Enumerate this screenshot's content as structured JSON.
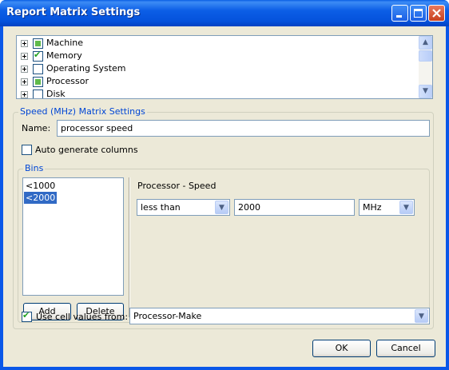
{
  "window": {
    "title": "Report Matrix Settings"
  },
  "tree": {
    "items": [
      {
        "label": "Machine",
        "state": "partial"
      },
      {
        "label": "Memory",
        "state": "checked"
      },
      {
        "label": "Operating System",
        "state": "unchecked"
      },
      {
        "label": "Processor",
        "state": "partial"
      },
      {
        "label": "Disk",
        "state": "unchecked"
      }
    ]
  },
  "matrix_settings": {
    "title": "Speed (MHz) Matrix Settings",
    "name_label": "Name:",
    "name_value": "processor speed",
    "auto_generate_label": "Auto generate columns",
    "auto_generate_checked": false
  },
  "bins": {
    "title": "Bins",
    "items": [
      "<1000",
      "<2000"
    ],
    "selected_index": 1,
    "add_label": "Add",
    "delete_label": "Delete",
    "detail_title": "Processor - Speed",
    "operator": "less than",
    "value": "2000",
    "unit": "MHz"
  },
  "cell_values": {
    "checked": true,
    "label": "Use cell values from:",
    "source": "Processor-Make"
  },
  "footer": {
    "ok_label": "OK",
    "cancel_label": "Cancel"
  },
  "icons": {
    "minimize": "minimize-icon",
    "maximize": "maximize-icon",
    "close": "close-icon",
    "dropdown": "chevron-down-icon",
    "scroll_up": "chevron-up-icon",
    "scroll_down": "chevron-down-icon"
  },
  "colors": {
    "title_bar": "#0a57e8",
    "group_label": "#0046d5",
    "selection": "#316ac5",
    "dialog_bg": "#ece9d8",
    "check_mark": "#21a121",
    "partial_fill": "#5fba4b"
  }
}
